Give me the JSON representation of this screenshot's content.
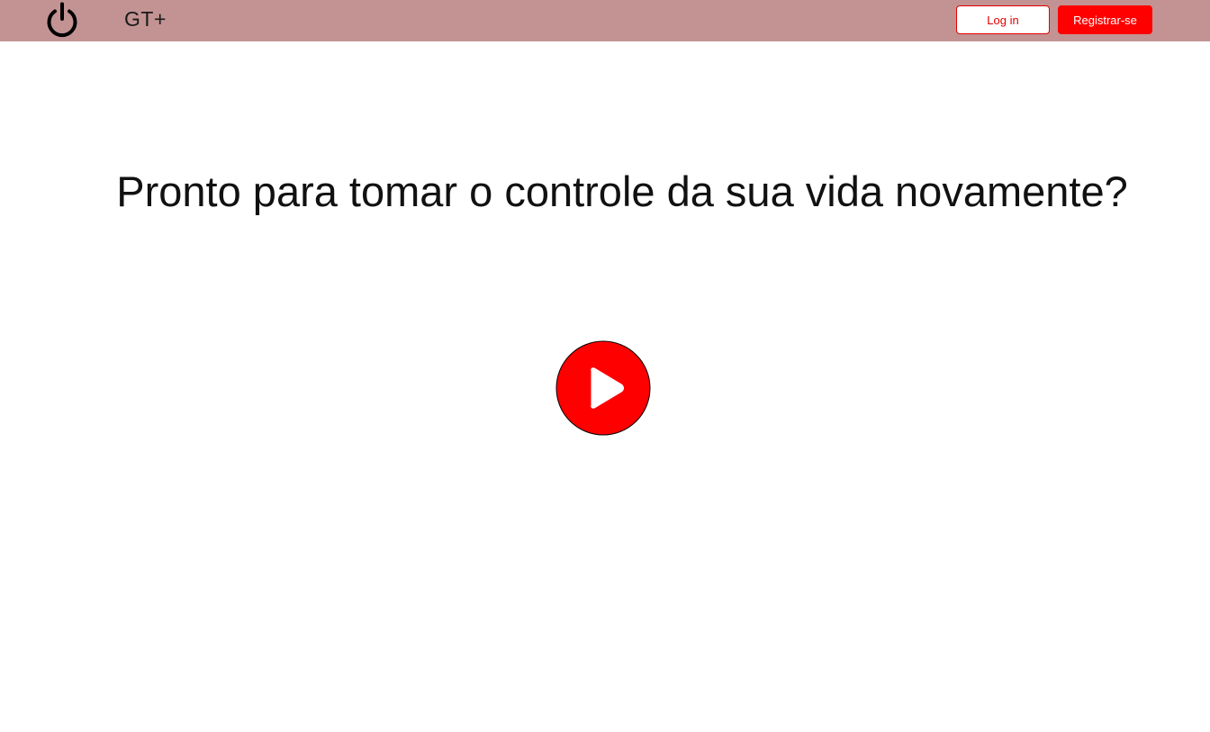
{
  "header": {
    "logo_icon": "power-icon",
    "brand": "GT+",
    "login_label": "Log in",
    "register_label": "Registrar-se",
    "background_color": "#c39393"
  },
  "hero": {
    "headline": "Pronto para tomar o controle da sua vida novamente?",
    "play_icon": "play-icon",
    "accent_color": "#ff0000"
  }
}
